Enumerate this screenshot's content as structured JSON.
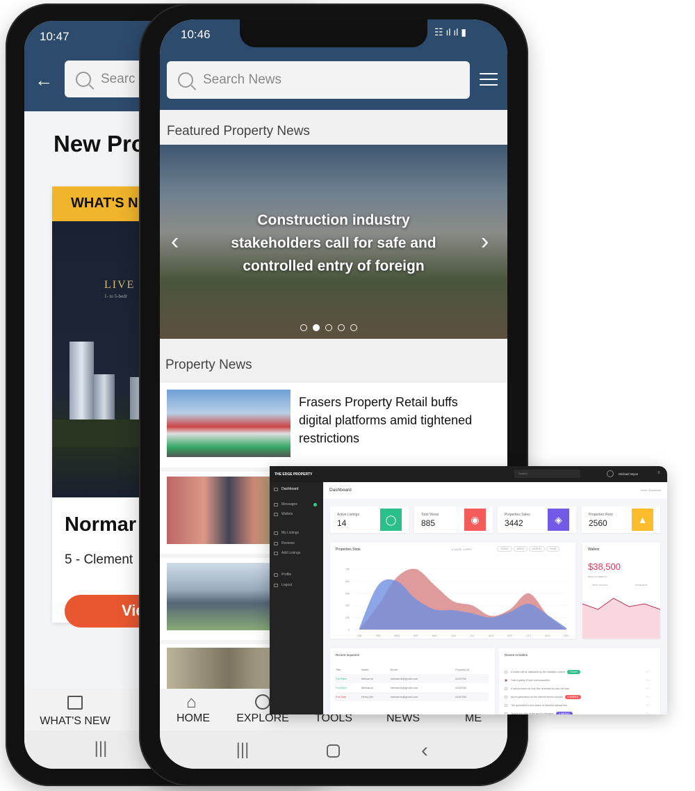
{
  "left_phone": {
    "status_time": "10:47",
    "search_placeholder": "Searc",
    "page_title": "New Pro",
    "card_banner": "WHAT'S N",
    "image_text": "LIVE I",
    "image_subtext": "1- to 5-bedr",
    "card_title": "Normar",
    "card_address": "5 - Clement",
    "card_button": "Vie",
    "bottom_nav": "WHAT'S NEW"
  },
  "right_phone": {
    "status_time": "10:46",
    "search_placeholder": "Search News",
    "featured_heading": "Featured Property News",
    "featured_caption": "Construction industry stakeholders call for safe and controlled entry of foreign",
    "carousel": {
      "count": 5,
      "active": 1
    },
    "news_heading": "Property News",
    "news": [
      {
        "title": "Frasers Property Retail buffs digital platforms amid tightened restrictions"
      },
      {
        "title": ""
      },
      {
        "title": ""
      },
      {
        "title": ""
      }
    ],
    "bottom_nav": [
      {
        "label": "HOME",
        "icon": "home-icon"
      },
      {
        "label": "EXPLORE",
        "icon": "search-icon"
      },
      {
        "label": "TOOLS"
      },
      {
        "label": "NEWS"
      },
      {
        "label": "ME"
      }
    ]
  },
  "dashboard": {
    "brand": "THE EDGE PROPERTY",
    "search_placeholder": "Search",
    "user": "Michael Wyan",
    "sidebar": [
      "Dashboard",
      "Messages",
      "Wallets",
      "My Listings",
      "Reviews",
      "Add Listings",
      "Profile",
      "Logout"
    ],
    "page_title": "Dashboard",
    "breadcrumb": "Home / Dashboard",
    "stats": [
      {
        "label": "Active Listings",
        "value": "14",
        "color": "#2bbf8a",
        "icon": "tag-icon"
      },
      {
        "label": "Total Views",
        "value": "885",
        "color": "#f55b5b",
        "icon": "eye-icon"
      },
      {
        "label": "Properties Sales",
        "value": "3442",
        "color": "#7259e8",
        "icon": "paint-icon"
      },
      {
        "label": "Properties Rent",
        "value": "2560",
        "color": "#fbbd2b",
        "icon": "flame-icon"
      }
    ],
    "chart_title": "Properties Stats",
    "chart_filters": [
      "TODAY",
      "WEEK",
      "MONTH",
      "YEAR"
    ],
    "wallet": {
      "title": "Wallets",
      "amount": "$38,500",
      "bank": "BANK OF AMERICA",
      "print": "PRINT INVOICE",
      "statement": "STATEMENT",
      "trend": [
        5,
        3,
        7,
        4,
        5,
        3
      ]
    },
    "inquiries": {
      "title": "Recent Inqueries",
      "columns": [
        "Title",
        "Name",
        "Email",
        "Property ID"
      ],
      "rows": [
        [
          "For Rent",
          "Melwarne",
          "melwarne@gmail.com",
          "#100756"
        ],
        [
          "For Rent",
          "Melwarne",
          "melwarne@gmail.com",
          "#100756"
        ],
        [
          "For Sale",
          "Henry Wu",
          "melwarne@gmail.com",
          "#100756"
        ]
      ]
    },
    "activities": {
      "title": "Recent Activities",
      "items": [
        {
          "text": "A reader will be distracted by the readable content",
          "badge": "TODAY",
          "badge_color": "#2bbf8a",
          "checked": false
        },
        {
          "text": "Took a galley of type and scrambled",
          "badge": "",
          "checked": true
        },
        {
          "text": "It has survived not only five centuries but also the leap",
          "badge": "",
          "checked": false
        },
        {
          "text": "Ipsum generators on the Internet tend to chunks",
          "badge": "2 WEEKS",
          "badge_color": "#f55b5b",
          "checked": false
        },
        {
          "text": "The generated Lorem Ipsum is therefore always free",
          "badge": "",
          "checked": false
        },
        {
          "text": "Taught the cities of the word to literature",
          "badge": "3 WEEKS",
          "badge_color": "#7259e8",
          "checked": false
        }
      ]
    }
  },
  "chart_data": {
    "type": "area",
    "title": "Properties Stats",
    "categories": [
      "JAN",
      "FEB",
      "MAR",
      "APR",
      "MAY",
      "JUN",
      "JUL",
      "AUG",
      "SEP",
      "OCT",
      "NOV",
      "DEC"
    ],
    "yticks": [
      "0",
      "15K",
      "30K",
      "45K",
      "60K",
      "75K"
    ],
    "ylim": [
      0,
      75000
    ],
    "legend_placement": "top-right",
    "series": [
      {
        "name": "SALES",
        "color": "#6f8fe0",
        "values": [
          2000,
          55000,
          60000,
          38000,
          25000,
          24000,
          20000,
          15000,
          22000,
          32000,
          18000,
          2000
        ]
      },
      {
        "name": "RENT",
        "color": "#d98a8a",
        "values": [
          0,
          30000,
          65000,
          75000,
          55000,
          35000,
          30000,
          17000,
          25000,
          45000,
          18000,
          0
        ]
      }
    ],
    "grid": true
  }
}
